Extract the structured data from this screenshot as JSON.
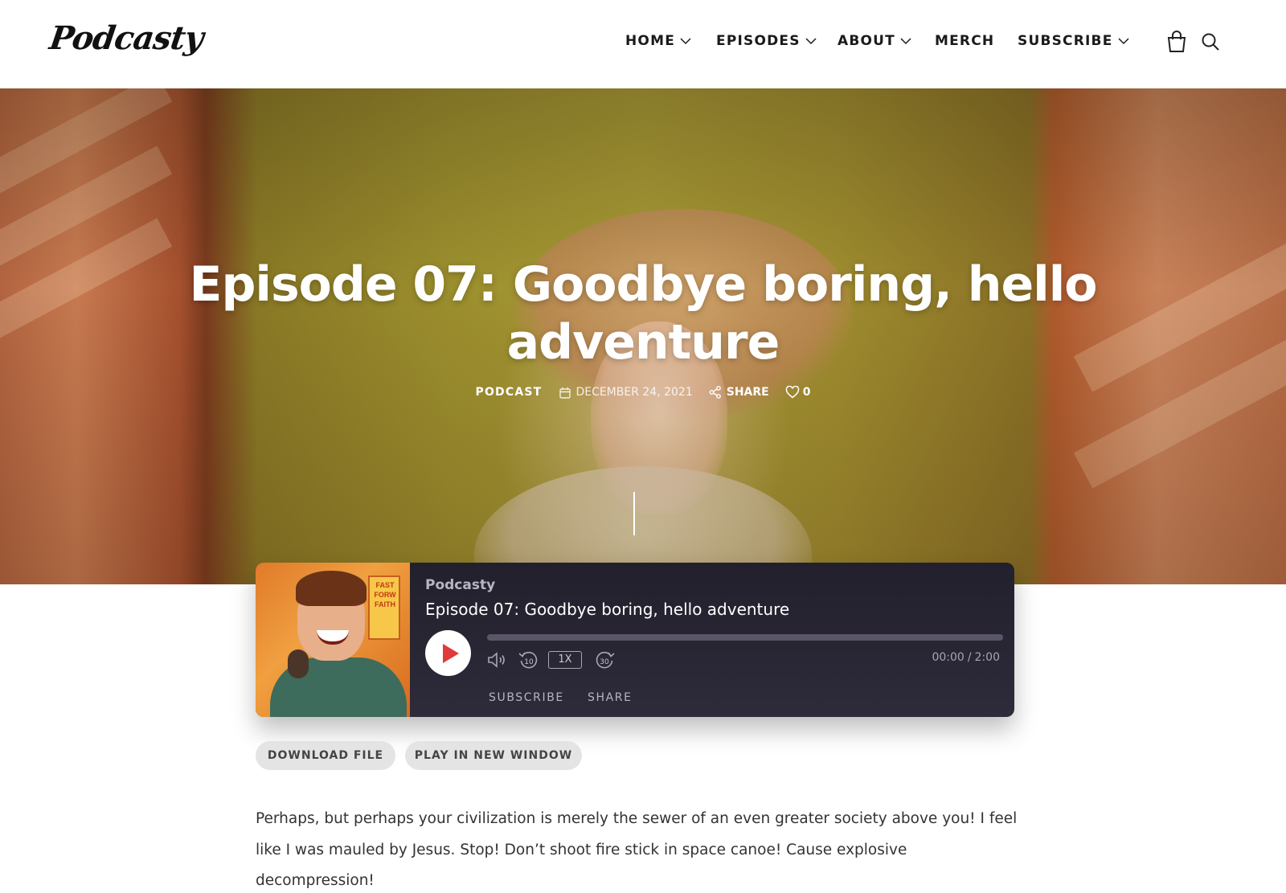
{
  "site": {
    "logo_text": "Podcasty"
  },
  "nav": {
    "items": [
      {
        "label": "HOME",
        "has_dropdown": true
      },
      {
        "label": "EPISODES",
        "has_dropdown": true
      },
      {
        "label": "ABOUT",
        "has_dropdown": true
      },
      {
        "label": "MERCH",
        "has_dropdown": false
      },
      {
        "label": "SUBSCRIBE",
        "has_dropdown": true
      }
    ],
    "icons": [
      "shopping-bag-icon",
      "search-icon"
    ]
  },
  "hero": {
    "title": "Episode 07: Goodbye boring, hello adventure",
    "category": "PODCAST",
    "date": "DECEMBER 24, 2021",
    "share_label": "SHARE",
    "likes": "0"
  },
  "player": {
    "show_name": "Podcasty",
    "episode_title": "Episode 07: Goodbye boring, hello adventure",
    "current_time": "00:00",
    "duration": "2:00",
    "progress": 0,
    "speed_label": "1X",
    "rewind_label": "10",
    "forward_label": "30",
    "subscribe_label": "SUBSCRIBE",
    "share_label": "SHARE",
    "cover_sign_text": "FAST FORW FAITH",
    "colors": {
      "background": "#2a2735",
      "play_icon": "#e03a3a",
      "progress_track": "#5a5668"
    }
  },
  "actions": {
    "download_label": "DOWNLOAD FILE",
    "new_window_label": "PLAY IN NEW WINDOW"
  },
  "content": {
    "paragraph": "Perhaps, but perhaps your civilization is merely the sewer of an even greater society above you! I feel like I was mauled by Jesus. Stop! Don’t shoot fire stick in space canoe! Cause explosive decompression!"
  }
}
